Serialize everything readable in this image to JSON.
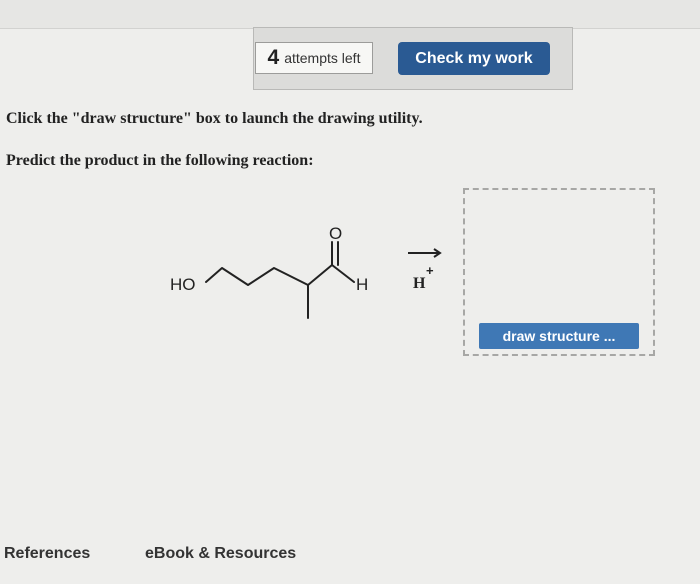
{
  "header": {
    "attempts_count": "4",
    "attempts_label": "attempts left",
    "check_button_label": "Check my work",
    "check_button_color": "#2a5a93"
  },
  "instructions": {
    "line1": "Click the \"draw structure\" box to launch the drawing utility.",
    "line2": "Predict the product in the following reaction:"
  },
  "reaction": {
    "hydroxyl_label": "HO",
    "oxygen_label": "O",
    "hydrogen_label": "H",
    "reagent_label": "H",
    "reagent_charge": "+"
  },
  "drawing_area": {
    "button_label": "draw structure ...",
    "button_color": "#3f78b5"
  },
  "footer": {
    "references_label": "References",
    "ebook_label": "eBook & Resources"
  }
}
